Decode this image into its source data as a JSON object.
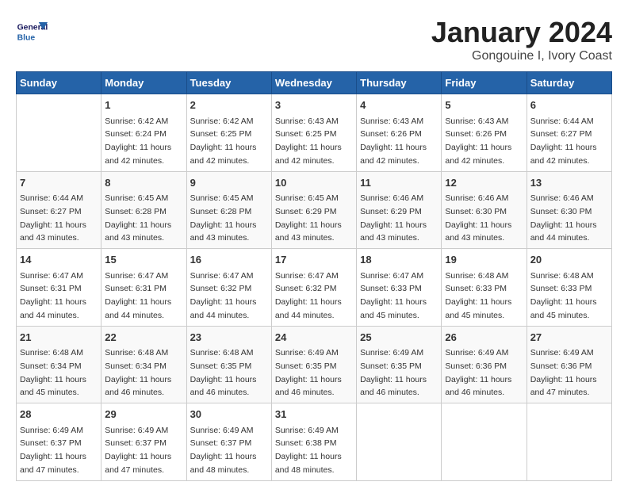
{
  "logo": {
    "line1": "General",
    "line2": "Blue"
  },
  "title": "January 2024",
  "subtitle": "Gongouine I, Ivory Coast",
  "days_of_week": [
    "Sunday",
    "Monday",
    "Tuesday",
    "Wednesday",
    "Thursday",
    "Friday",
    "Saturday"
  ],
  "weeks": [
    [
      {
        "day": "",
        "info": ""
      },
      {
        "day": "1",
        "info": "Sunrise: 6:42 AM\nSunset: 6:24 PM\nDaylight: 11 hours\nand 42 minutes."
      },
      {
        "day": "2",
        "info": "Sunrise: 6:42 AM\nSunset: 6:25 PM\nDaylight: 11 hours\nand 42 minutes."
      },
      {
        "day": "3",
        "info": "Sunrise: 6:43 AM\nSunset: 6:25 PM\nDaylight: 11 hours\nand 42 minutes."
      },
      {
        "day": "4",
        "info": "Sunrise: 6:43 AM\nSunset: 6:26 PM\nDaylight: 11 hours\nand 42 minutes."
      },
      {
        "day": "5",
        "info": "Sunrise: 6:43 AM\nSunset: 6:26 PM\nDaylight: 11 hours\nand 42 minutes."
      },
      {
        "day": "6",
        "info": "Sunrise: 6:44 AM\nSunset: 6:27 PM\nDaylight: 11 hours\nand 42 minutes."
      }
    ],
    [
      {
        "day": "7",
        "info": "Sunrise: 6:44 AM\nSunset: 6:27 PM\nDaylight: 11 hours\nand 43 minutes."
      },
      {
        "day": "8",
        "info": "Sunrise: 6:45 AM\nSunset: 6:28 PM\nDaylight: 11 hours\nand 43 minutes."
      },
      {
        "day": "9",
        "info": "Sunrise: 6:45 AM\nSunset: 6:28 PM\nDaylight: 11 hours\nand 43 minutes."
      },
      {
        "day": "10",
        "info": "Sunrise: 6:45 AM\nSunset: 6:29 PM\nDaylight: 11 hours\nand 43 minutes."
      },
      {
        "day": "11",
        "info": "Sunrise: 6:46 AM\nSunset: 6:29 PM\nDaylight: 11 hours\nand 43 minutes."
      },
      {
        "day": "12",
        "info": "Sunrise: 6:46 AM\nSunset: 6:30 PM\nDaylight: 11 hours\nand 43 minutes."
      },
      {
        "day": "13",
        "info": "Sunrise: 6:46 AM\nSunset: 6:30 PM\nDaylight: 11 hours\nand 44 minutes."
      }
    ],
    [
      {
        "day": "14",
        "info": "Sunrise: 6:47 AM\nSunset: 6:31 PM\nDaylight: 11 hours\nand 44 minutes."
      },
      {
        "day": "15",
        "info": "Sunrise: 6:47 AM\nSunset: 6:31 PM\nDaylight: 11 hours\nand 44 minutes."
      },
      {
        "day": "16",
        "info": "Sunrise: 6:47 AM\nSunset: 6:32 PM\nDaylight: 11 hours\nand 44 minutes."
      },
      {
        "day": "17",
        "info": "Sunrise: 6:47 AM\nSunset: 6:32 PM\nDaylight: 11 hours\nand 44 minutes."
      },
      {
        "day": "18",
        "info": "Sunrise: 6:47 AM\nSunset: 6:33 PM\nDaylight: 11 hours\nand 45 minutes."
      },
      {
        "day": "19",
        "info": "Sunrise: 6:48 AM\nSunset: 6:33 PM\nDaylight: 11 hours\nand 45 minutes."
      },
      {
        "day": "20",
        "info": "Sunrise: 6:48 AM\nSunset: 6:33 PM\nDaylight: 11 hours\nand 45 minutes."
      }
    ],
    [
      {
        "day": "21",
        "info": "Sunrise: 6:48 AM\nSunset: 6:34 PM\nDaylight: 11 hours\nand 45 minutes."
      },
      {
        "day": "22",
        "info": "Sunrise: 6:48 AM\nSunset: 6:34 PM\nDaylight: 11 hours\nand 46 minutes."
      },
      {
        "day": "23",
        "info": "Sunrise: 6:48 AM\nSunset: 6:35 PM\nDaylight: 11 hours\nand 46 minutes."
      },
      {
        "day": "24",
        "info": "Sunrise: 6:49 AM\nSunset: 6:35 PM\nDaylight: 11 hours\nand 46 minutes."
      },
      {
        "day": "25",
        "info": "Sunrise: 6:49 AM\nSunset: 6:35 PM\nDaylight: 11 hours\nand 46 minutes."
      },
      {
        "day": "26",
        "info": "Sunrise: 6:49 AM\nSunset: 6:36 PM\nDaylight: 11 hours\nand 46 minutes."
      },
      {
        "day": "27",
        "info": "Sunrise: 6:49 AM\nSunset: 6:36 PM\nDaylight: 11 hours\nand 47 minutes."
      }
    ],
    [
      {
        "day": "28",
        "info": "Sunrise: 6:49 AM\nSunset: 6:37 PM\nDaylight: 11 hours\nand 47 minutes."
      },
      {
        "day": "29",
        "info": "Sunrise: 6:49 AM\nSunset: 6:37 PM\nDaylight: 11 hours\nand 47 minutes."
      },
      {
        "day": "30",
        "info": "Sunrise: 6:49 AM\nSunset: 6:37 PM\nDaylight: 11 hours\nand 48 minutes."
      },
      {
        "day": "31",
        "info": "Sunrise: 6:49 AM\nSunset: 6:38 PM\nDaylight: 11 hours\nand 48 minutes."
      },
      {
        "day": "",
        "info": ""
      },
      {
        "day": "",
        "info": ""
      },
      {
        "day": "",
        "info": ""
      }
    ]
  ]
}
